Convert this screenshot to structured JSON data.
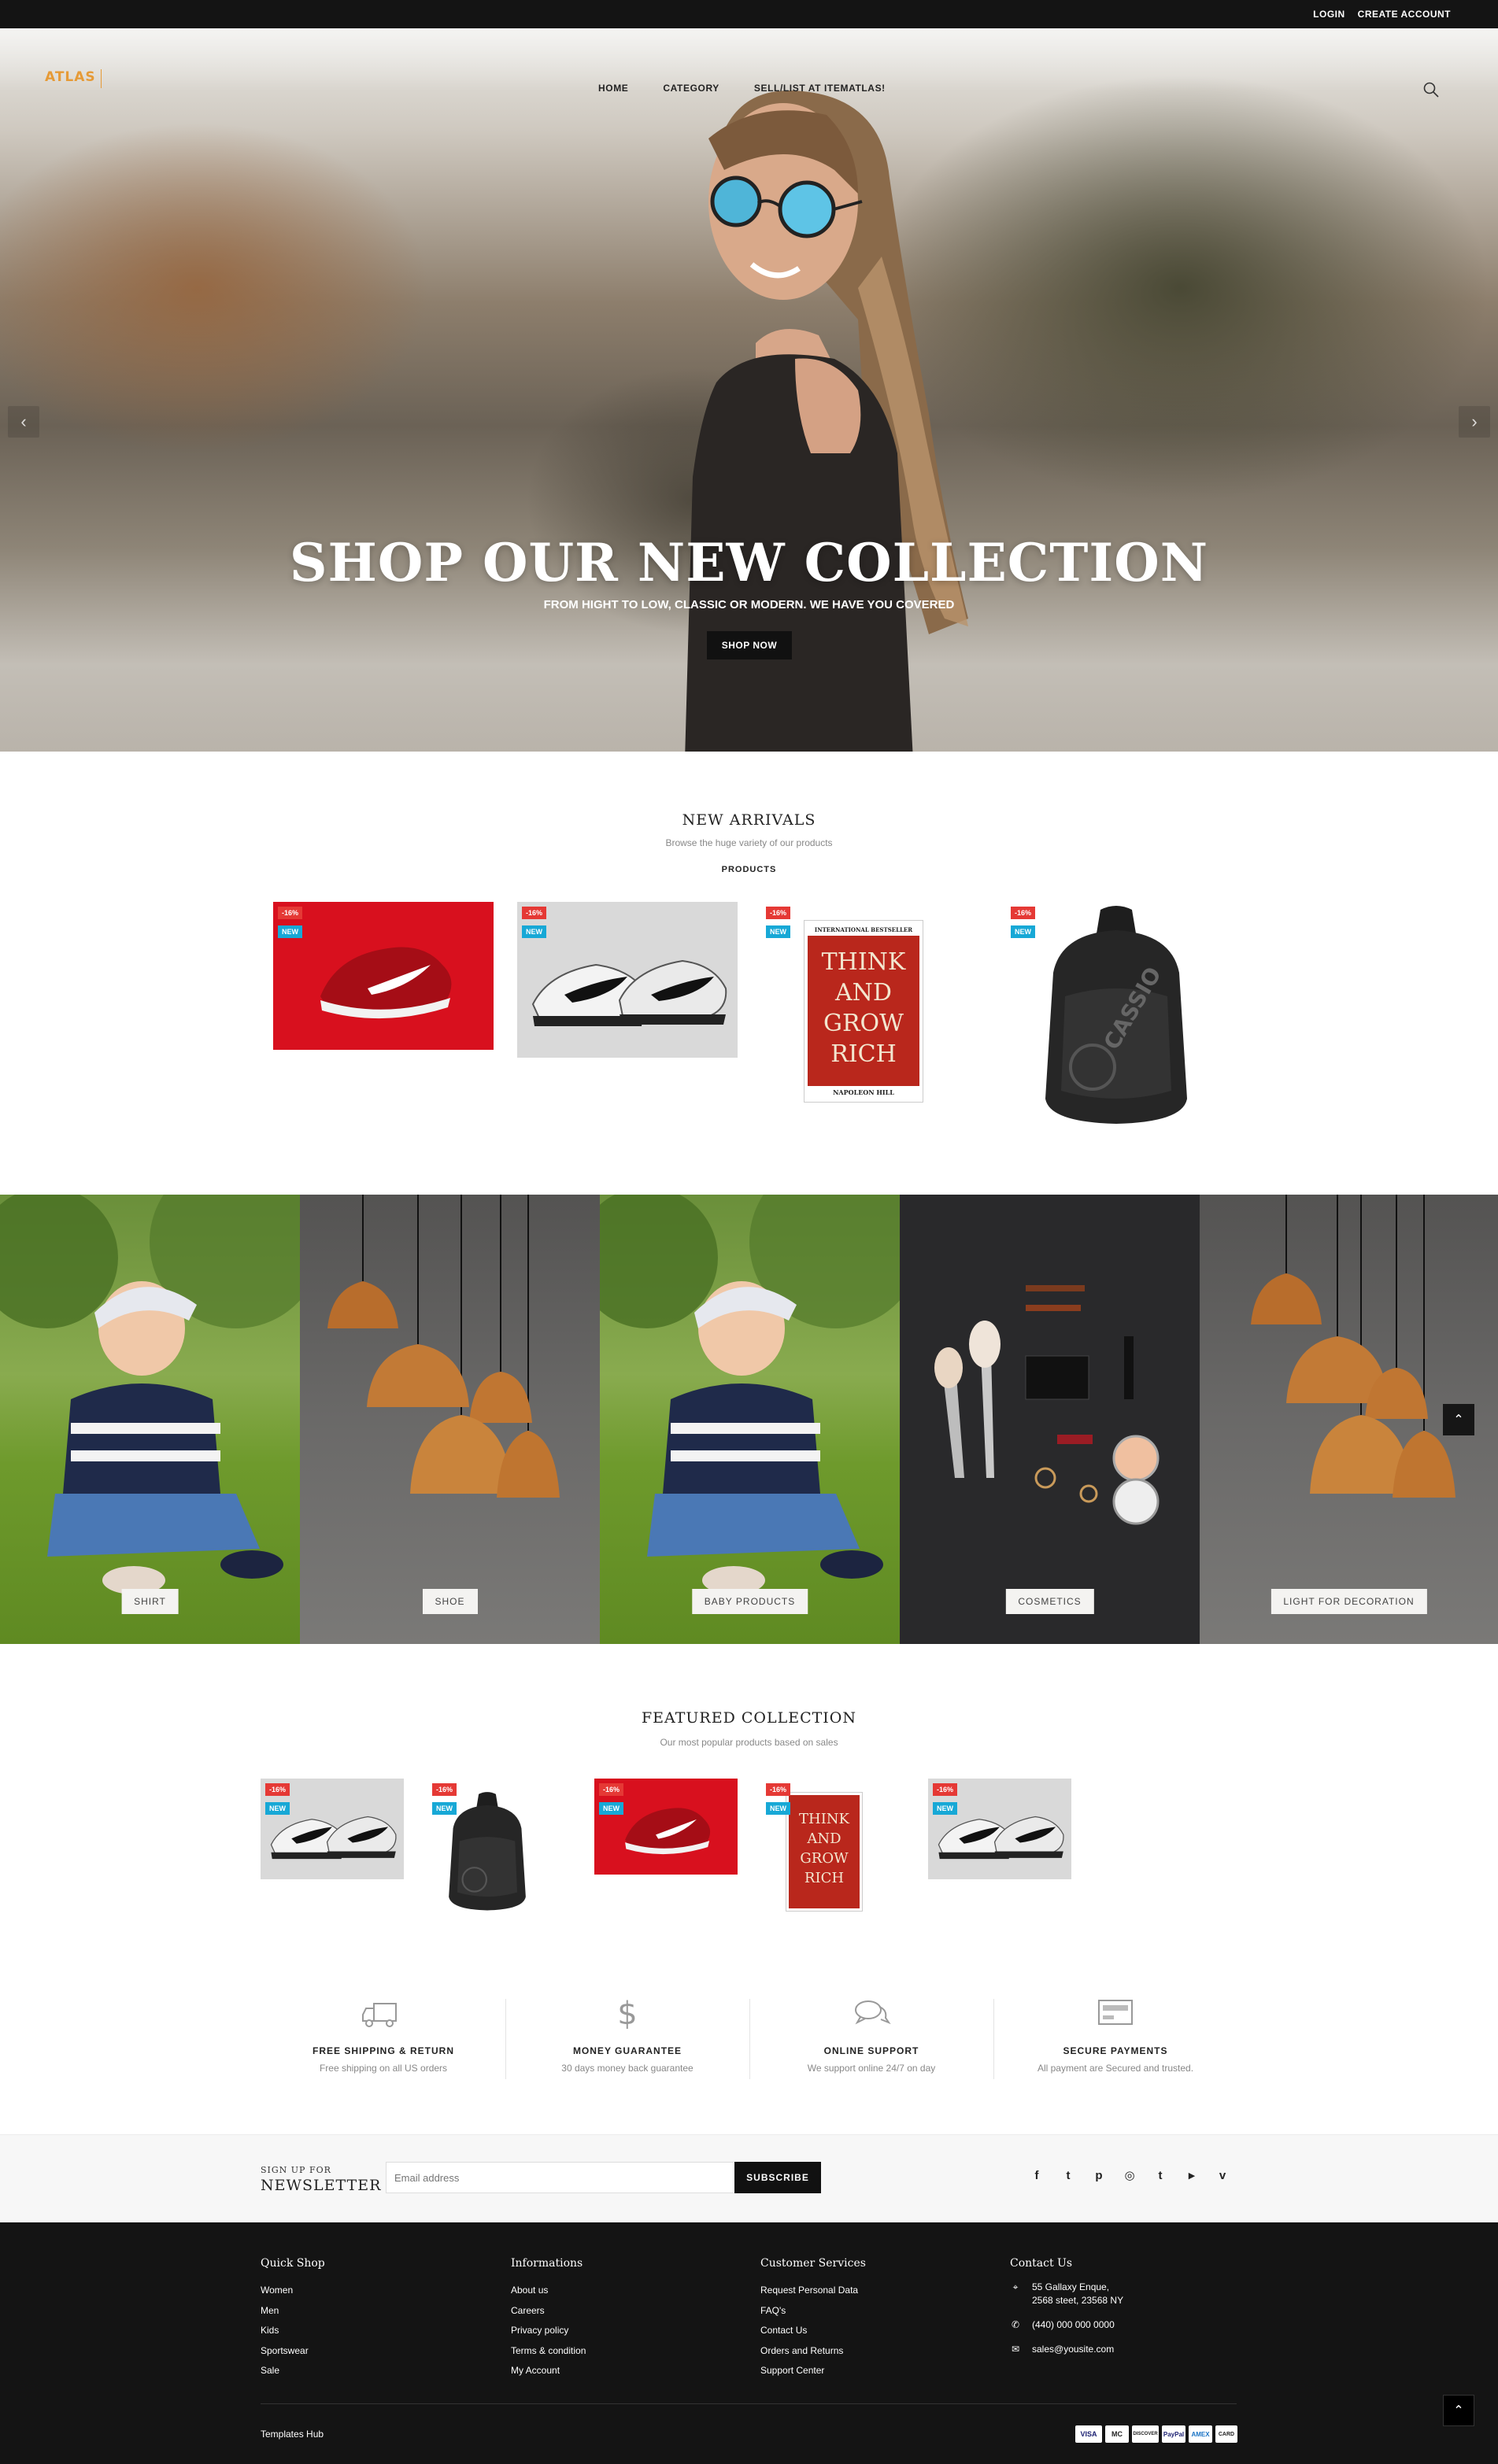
{
  "topbar": {
    "login": "LOGIN",
    "create_account": "CREATE ACCOUNT"
  },
  "header": {
    "logo": "ATLAS",
    "nav": [
      {
        "label": "HOME"
      },
      {
        "label": "CATEGORY"
      },
      {
        "label": "SELL/LIST AT ITEMATLAS!"
      }
    ],
    "search_icon": "search-icon"
  },
  "hero": {
    "title": "SHOP OUR NEW COLLECTION",
    "subtitle": "FROM HIGHT TO LOW, CLASSIC OR MODERN. WE HAVE YOU COVERED",
    "button": "SHOP NOW"
  },
  "new_arrivals": {
    "title": "NEW ARRIVALS",
    "subtitle": "Browse the huge variety of our products",
    "tab": "PRODUCTS",
    "products": [
      {
        "sale": "-16%",
        "new": "NEW",
        "kind": "red-sneaker"
      },
      {
        "sale": "-16%",
        "new": "NEW",
        "kind": "grey-sneaker"
      },
      {
        "sale": "-16%",
        "new": "NEW",
        "kind": "book"
      },
      {
        "sale": "-16%",
        "new": "NEW",
        "kind": "backpack"
      }
    ],
    "book": {
      "top": "INTERNATIONAL BESTSELLER",
      "title": [
        "THINK",
        "AND",
        "GROW",
        "RICH"
      ],
      "author": "NAPOLEON HILL"
    },
    "backpack_brand": "CASSIO"
  },
  "categories": [
    {
      "label": "SHIRT"
    },
    {
      "label": "SHOE"
    },
    {
      "label": "BABY PRODUCTS"
    },
    {
      "label": "COSMETICS"
    },
    {
      "label": "LIGHT FOR DECORATION"
    }
  ],
  "featured": {
    "title": "FEATURED COLLECTION",
    "subtitle": "Our most popular products based on sales",
    "products": [
      {
        "sale": "-16%",
        "new": "NEW",
        "kind": "grey-sneaker"
      },
      {
        "sale": "-16%",
        "new": "NEW",
        "kind": "backpack"
      },
      {
        "sale": "-16%",
        "new": "NEW",
        "kind": "red-sneaker"
      },
      {
        "sale": "-16%",
        "new": "NEW",
        "kind": "book"
      },
      {
        "sale": "-16%",
        "new": "NEW",
        "kind": "grey-sneaker"
      }
    ]
  },
  "services": [
    {
      "icon": "truck-icon",
      "title": "FREE SHIPPING & RETURN",
      "desc": "Free shipping on all US orders"
    },
    {
      "icon": "dollar-icon",
      "title": "MONEY GUARANTEE",
      "desc": "30 days money back guarantee"
    },
    {
      "icon": "chat-icon",
      "title": "ONLINE SUPPORT",
      "desc": "We support online 24/7 on day"
    },
    {
      "icon": "payment-card-icon",
      "title": "SECURE PAYMENTS",
      "desc": "All payment are Secured and trusted."
    }
  ],
  "newsletter": {
    "small": "SIGN UP FOR",
    "big": "NEWSLETTER",
    "placeholder": "Email address",
    "button": "SUBSCRIBE",
    "social": [
      {
        "icon": "facebook-icon",
        "glyph": "f"
      },
      {
        "icon": "twitter-icon",
        "glyph": "t"
      },
      {
        "icon": "pinterest-icon",
        "glyph": "p"
      },
      {
        "icon": "instagram-icon",
        "glyph": "◎"
      },
      {
        "icon": "tumblr-icon",
        "glyph": "t"
      },
      {
        "icon": "youtube-icon",
        "glyph": "▶"
      },
      {
        "icon": "vimeo-icon",
        "glyph": "v"
      }
    ]
  },
  "footer": {
    "quick_shop": {
      "title": "Quick Shop",
      "items": [
        "Women",
        "Men",
        "Kids",
        "Sportswear",
        "Sale"
      ]
    },
    "informations": {
      "title": "Informations",
      "items": [
        "About us",
        "Careers",
        "Privacy policy",
        "Terms & condition",
        "My Account"
      ]
    },
    "customer_services": {
      "title": "Customer Services",
      "items": [
        "Request Personal Data",
        "FAQ's",
        "Contact Us",
        "Orders and Returns",
        "Support Center"
      ]
    },
    "contact": {
      "title": "Contact Us",
      "address_line1": "55 Gallaxy Enque,",
      "address_line2": "2568 steet, 23568 NY",
      "phone": "(440) 000 000 0000",
      "email": "sales@yousite.com"
    },
    "copyright": "Templates Hub",
    "payments": [
      "VISA",
      "MC",
      "DISCOVER",
      "PayPal",
      "AMEX",
      "CARD"
    ]
  },
  "colors": {
    "accent": "#e69a36",
    "sale_badge": "#e53935",
    "new_badge": "#17a8d6",
    "dark": "#141414"
  }
}
